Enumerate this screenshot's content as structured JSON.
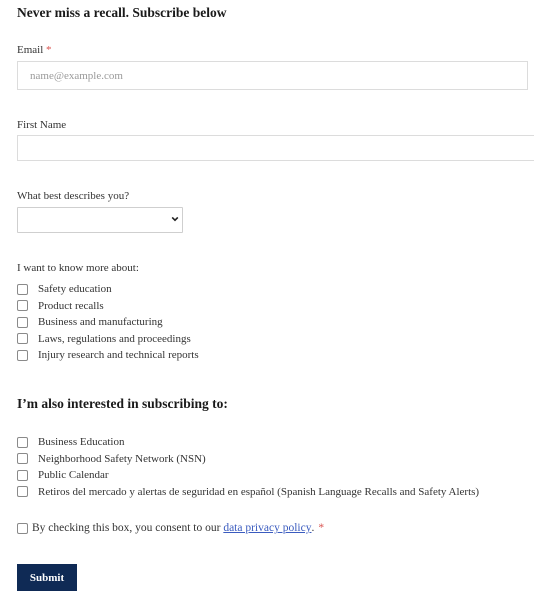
{
  "form": {
    "title": "Never miss a recall. Subscribe below",
    "email": {
      "label": "Email",
      "required_mark": "*",
      "placeholder": "name@example.com",
      "value": ""
    },
    "first_name": {
      "label": "First Name",
      "value": ""
    },
    "describes": {
      "label": "What best describes you?",
      "selected": ""
    },
    "interests": {
      "label": "I want to know more about:",
      "options": [
        {
          "label": "Safety education",
          "checked": false
        },
        {
          "label": "Product recalls",
          "checked": false
        },
        {
          "label": "Business and manufacturing",
          "checked": false
        },
        {
          "label": "Laws, regulations and proceedings",
          "checked": false
        },
        {
          "label": "Injury research and technical reports",
          "checked": false
        }
      ]
    },
    "subscriptions": {
      "heading": "I’m also interested in subscribing to:",
      "options": [
        {
          "label": "Business Education",
          "checked": false
        },
        {
          "label": "Neighborhood Safety Network (NSN)",
          "checked": false
        },
        {
          "label": "Public Calendar",
          "checked": false
        },
        {
          "label": "Retiros del mercado y alertas de seguridad en español (Spanish Language Recalls and Safety Alerts)",
          "checked": false
        }
      ]
    },
    "consent": {
      "text_before": "By checking this box, you consent to our ",
      "link_text": "data privacy policy",
      "text_after": ".",
      "required_mark": "*",
      "checked": false
    },
    "submit_label": "Submit"
  },
  "colors": {
    "button_bg": "#0f2a55",
    "link": "#3a5bbf",
    "required": "#d9534f"
  }
}
